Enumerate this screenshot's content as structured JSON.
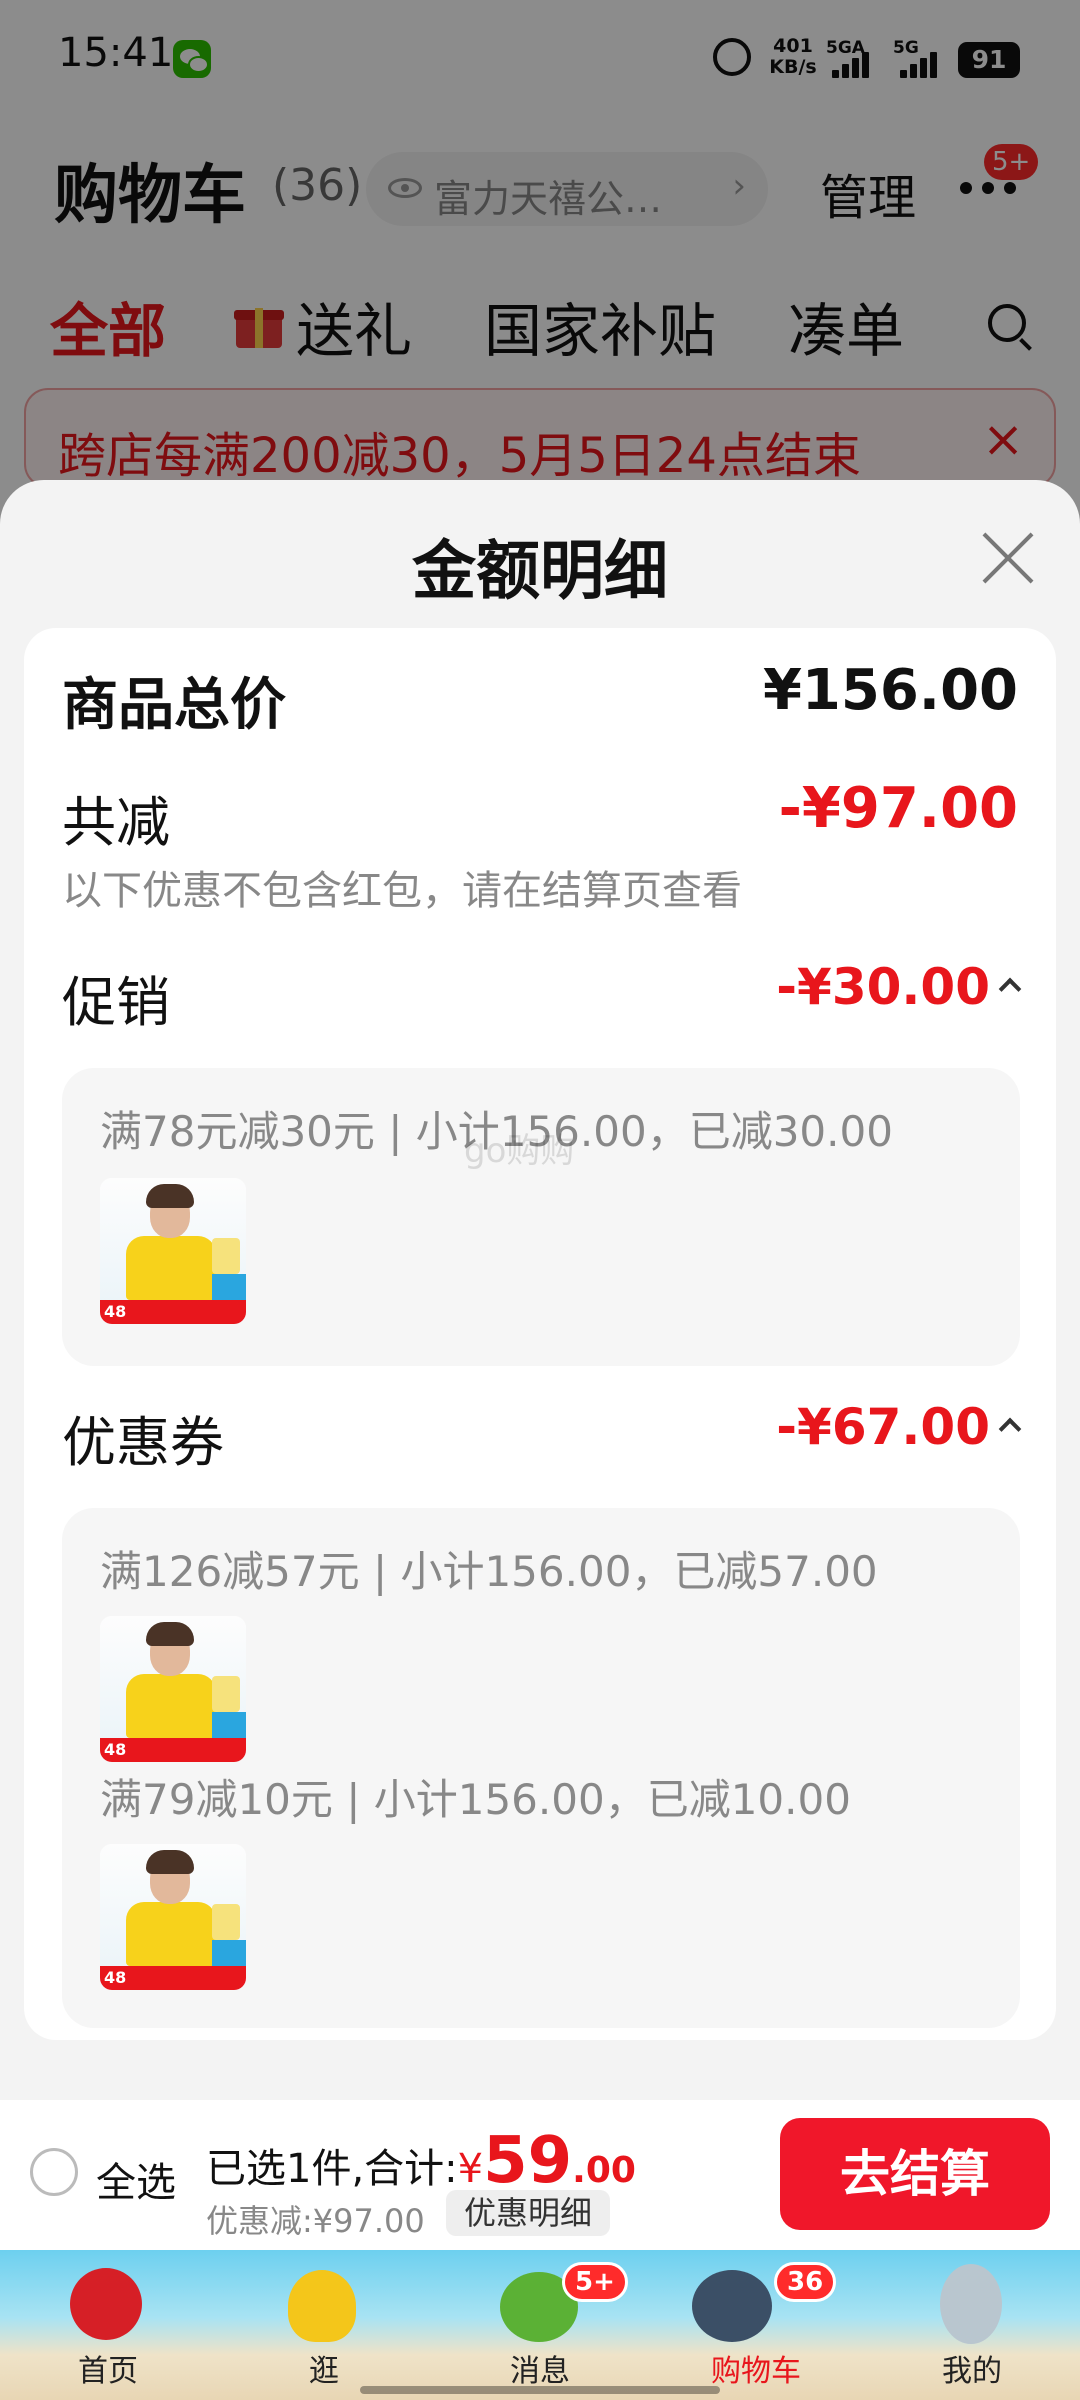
{
  "status_bar": {
    "time": "15:41",
    "net_speed_value": "401",
    "net_speed_unit": "KB/s",
    "signal_1": "5GA",
    "signal_2": "5G",
    "battery": "91"
  },
  "cart_header": {
    "title": "购物车",
    "count": "(36)",
    "address": "富力天禧公…",
    "manage": "管理",
    "more_badge": "5+"
  },
  "cart_tabs": [
    "全部",
    "送礼",
    "国家补贴",
    "凑单"
  ],
  "promo_banner": {
    "text": "跨店每满200减30，5月5日24点结束",
    "close": "×"
  },
  "sheet": {
    "title": "金额明细",
    "total_label": "商品总价",
    "total_value": "¥156.00",
    "reduce_label": "共减",
    "reduce_value": "-¥97.00",
    "note": "以下优惠不包含红包，请在结算页查看",
    "watermark": "go购购",
    "promotion": {
      "label": "促销",
      "value": "-¥30.00",
      "rule": "满78元减30元 | 小计156.00，已减30.00"
    },
    "coupon": {
      "label": "优惠券",
      "value": "-¥67.00",
      "rules": [
        "满126减57元 | 小计156.00，已减57.00",
        "满79减10元 | 小计156.00，已减10.00"
      ]
    },
    "thumb_price_tag": "48"
  },
  "bottom_bar": {
    "select_all": "全选",
    "selected_prefix": "已选1件,合计:",
    "currency": "¥",
    "total_int": "59",
    "total_dec": ".00",
    "discount": "优惠减:¥97.00",
    "detail_button": "优惠明细",
    "checkout": "去结算"
  },
  "tab_bar": {
    "items": [
      "首页",
      "逛",
      "消息",
      "购物车",
      "我的"
    ],
    "message_badge": "5+",
    "cart_badge": "36",
    "active_index": 3
  },
  "colors": {
    "accent_red": "#e8161c",
    "checkout_red": "#f0172a",
    "sheet_bg": "#f3f3f3"
  }
}
